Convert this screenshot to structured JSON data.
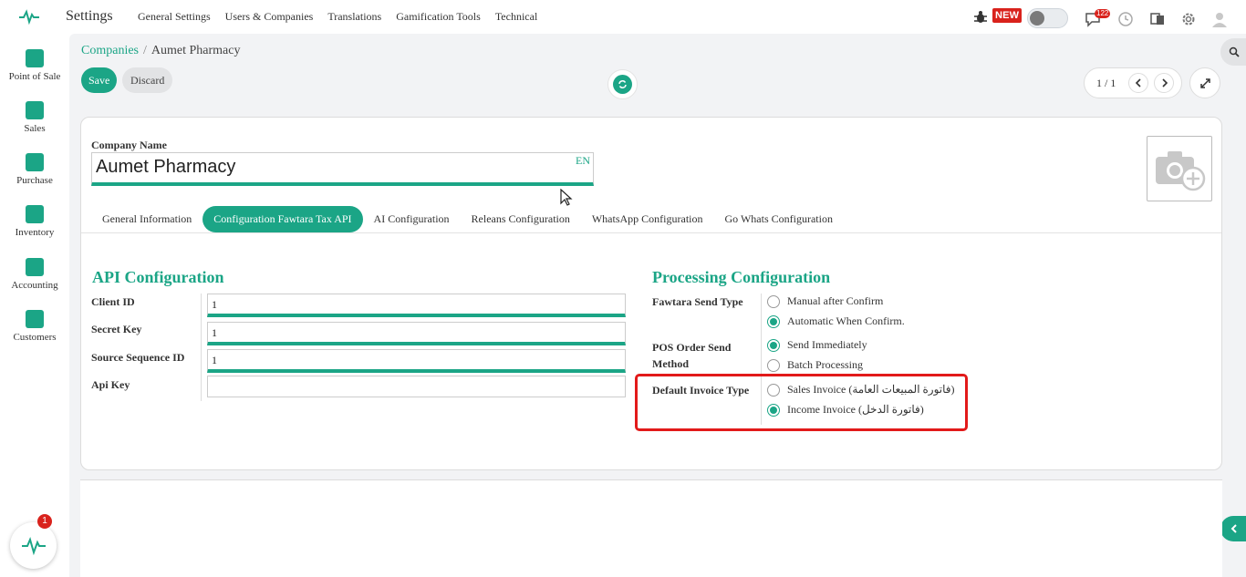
{
  "app": {
    "title": "Settings"
  },
  "topnav": [
    "General Settings",
    "Users & Companies",
    "Translations",
    "Gamification Tools",
    "Technical"
  ],
  "header_right": {
    "new_badge": "NEW",
    "messages_count": "122"
  },
  "sidebar": {
    "items": [
      {
        "label": "Point of Sale",
        "icon": "monitor-icon"
      },
      {
        "label": "Sales",
        "icon": "sales-icon"
      },
      {
        "label": "Purchase",
        "icon": "dollar-icon"
      },
      {
        "label": "Inventory",
        "icon": "box-icon"
      },
      {
        "label": "Accounting",
        "icon": "calculator-icon"
      },
      {
        "label": "Customers",
        "icon": "users-icon"
      }
    ],
    "fab_badge": "1"
  },
  "breadcrumb": {
    "parent": "Companies",
    "separator": "/",
    "current": "Aumet Pharmacy"
  },
  "actions": {
    "save": "Save",
    "discard": "Discard"
  },
  "pager": {
    "text": "1 / 1"
  },
  "form": {
    "company_name_label": "Company Name",
    "company_name_value": "Aumet Pharmacy",
    "lang": "EN"
  },
  "tabs": [
    {
      "label": "General Information",
      "active": false
    },
    {
      "label": "Configuration Fawtara Tax API",
      "active": true
    },
    {
      "label": "AI Configuration",
      "active": false
    },
    {
      "label": "Releans Configuration",
      "active": false
    },
    {
      "label": "WhatsApp Configuration",
      "active": false
    },
    {
      "label": "Go Whats Configuration",
      "active": false
    }
  ],
  "api_config": {
    "title": "API Configuration",
    "client_id_label": "Client ID",
    "client_id_value": "1",
    "secret_key_label": "Secret Key",
    "secret_key_value": "1",
    "source_seq_label": "Source Sequence ID",
    "source_seq_value": "1",
    "api_key_label": "Api Key",
    "api_key_value": ""
  },
  "processing_config": {
    "title": "Processing Configuration",
    "send_type_label": "Fawtara Send Type",
    "send_type_opt1": "Manual after Confirm",
    "send_type_opt2": "Automatic When Confirm.",
    "pos_method_label_1": "POS Order Send",
    "pos_method_label_2": "Method",
    "pos_method_opt1": "Send Immediately",
    "pos_method_opt2": "Batch Processing",
    "invoice_type_label": "Default Invoice Type",
    "invoice_type_opt1": "Sales Invoice (فاتورة المبيعات العامة)",
    "invoice_type_opt2": "Income Invoice (فاتورة الدخل)"
  },
  "colors": {
    "accent": "#1ba586",
    "highlight": "#e21a1a",
    "badge": "#d9221c"
  }
}
